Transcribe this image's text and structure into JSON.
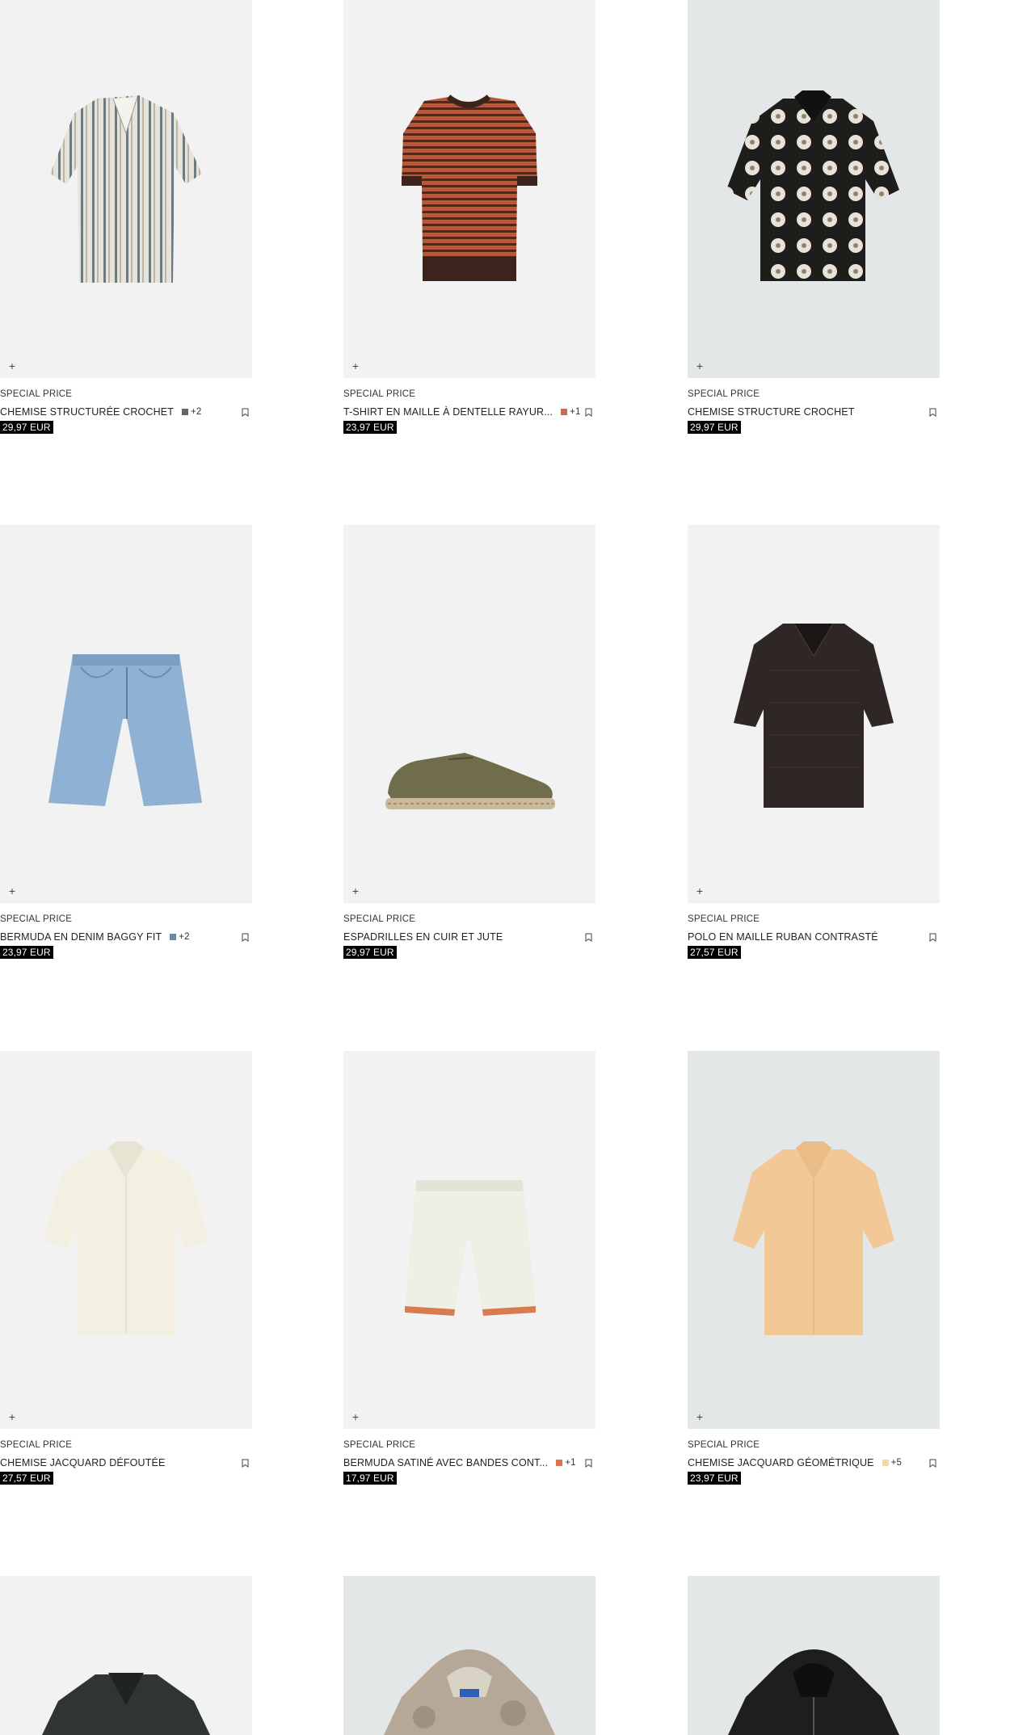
{
  "products": [
    {
      "label": "SPECIAL PRICE",
      "name": "CHEMISE STRUCTURÉE CROCHET",
      "price": "29,97 EUR",
      "swatch": "#666666",
      "more": "+2",
      "bg": "light",
      "icon": "plus-icon",
      "garment": "striped-crochet-shirt"
    },
    {
      "label": "SPECIAL PRICE",
      "name": "T-SHIRT EN MAILLE À DENTELLE RAYUR...",
      "price": "23,97 EUR",
      "swatch": "#c4704e",
      "more": "+1",
      "bg": "light",
      "icon": "plus-icon",
      "garment": "striped-knit-tshirt"
    },
    {
      "label": "SPECIAL PRICE",
      "name": "CHEMISE STRUCTURE CROCHET",
      "price": "29,97 EUR",
      "swatch": null,
      "more": "",
      "bg": "cool",
      "icon": "plus-icon",
      "garment": "floral-crochet-shirt"
    },
    {
      "label": "SPECIAL PRICE",
      "name": "BERMUDA EN DENIM BAGGY FIT",
      "price": "23,97 EUR",
      "swatch": "#6e87a6",
      "more": "+2",
      "bg": "light",
      "icon": "plus-icon",
      "garment": "denim-bermuda"
    },
    {
      "label": "SPECIAL PRICE",
      "name": "ESPADRILLES EN CUIR ET JUTE",
      "price": "29,97 EUR",
      "swatch": null,
      "more": "",
      "bg": "light",
      "icon": "plus-icon",
      "garment": "espadrille-shoe"
    },
    {
      "label": "SPECIAL PRICE",
      "name": "POLO EN MAILLE RUBAN CONTRASTÉ",
      "price": "27,57 EUR",
      "swatch": null,
      "more": "",
      "bg": "light",
      "icon": "plus-icon",
      "garment": "knit-polo"
    },
    {
      "label": "SPECIAL PRICE",
      "name": "CHEMISE JACQUARD DÉFOUTÉE",
      "price": "27,57 EUR",
      "swatch": null,
      "more": "",
      "bg": "light",
      "icon": "plus-icon",
      "garment": "white-jacquard-shirt"
    },
    {
      "label": "SPECIAL PRICE",
      "name": "BERMUDA SATINÉ AVEC BANDES CONT...",
      "price": "17,97 EUR",
      "swatch": "#d9764e",
      "more": "+1",
      "bg": "light",
      "icon": "plus-icon",
      "garment": "satin-bermuda"
    },
    {
      "label": "SPECIAL PRICE",
      "name": "CHEMISE JACQUARD GÉOMÉTRIQUE",
      "price": "23,97 EUR",
      "swatch": "#f0d7a7",
      "more": "+5",
      "bg": "cool",
      "icon": "plus-icon",
      "garment": "peach-jacquard-shirt"
    },
    {
      "label": "",
      "name": "",
      "price": "",
      "swatch": null,
      "more": "",
      "bg": "light",
      "icon": "plus-icon",
      "garment": "dark-knit-shirt"
    },
    {
      "label": "",
      "name": "",
      "price": "",
      "swatch": null,
      "more": "",
      "bg": "cool",
      "icon": "plus-icon",
      "garment": "camo-hoodie"
    },
    {
      "label": "",
      "name": "",
      "price": "",
      "swatch": null,
      "more": "",
      "bg": "cool",
      "icon": "plus-icon",
      "garment": "black-zip-hoodie"
    }
  ]
}
